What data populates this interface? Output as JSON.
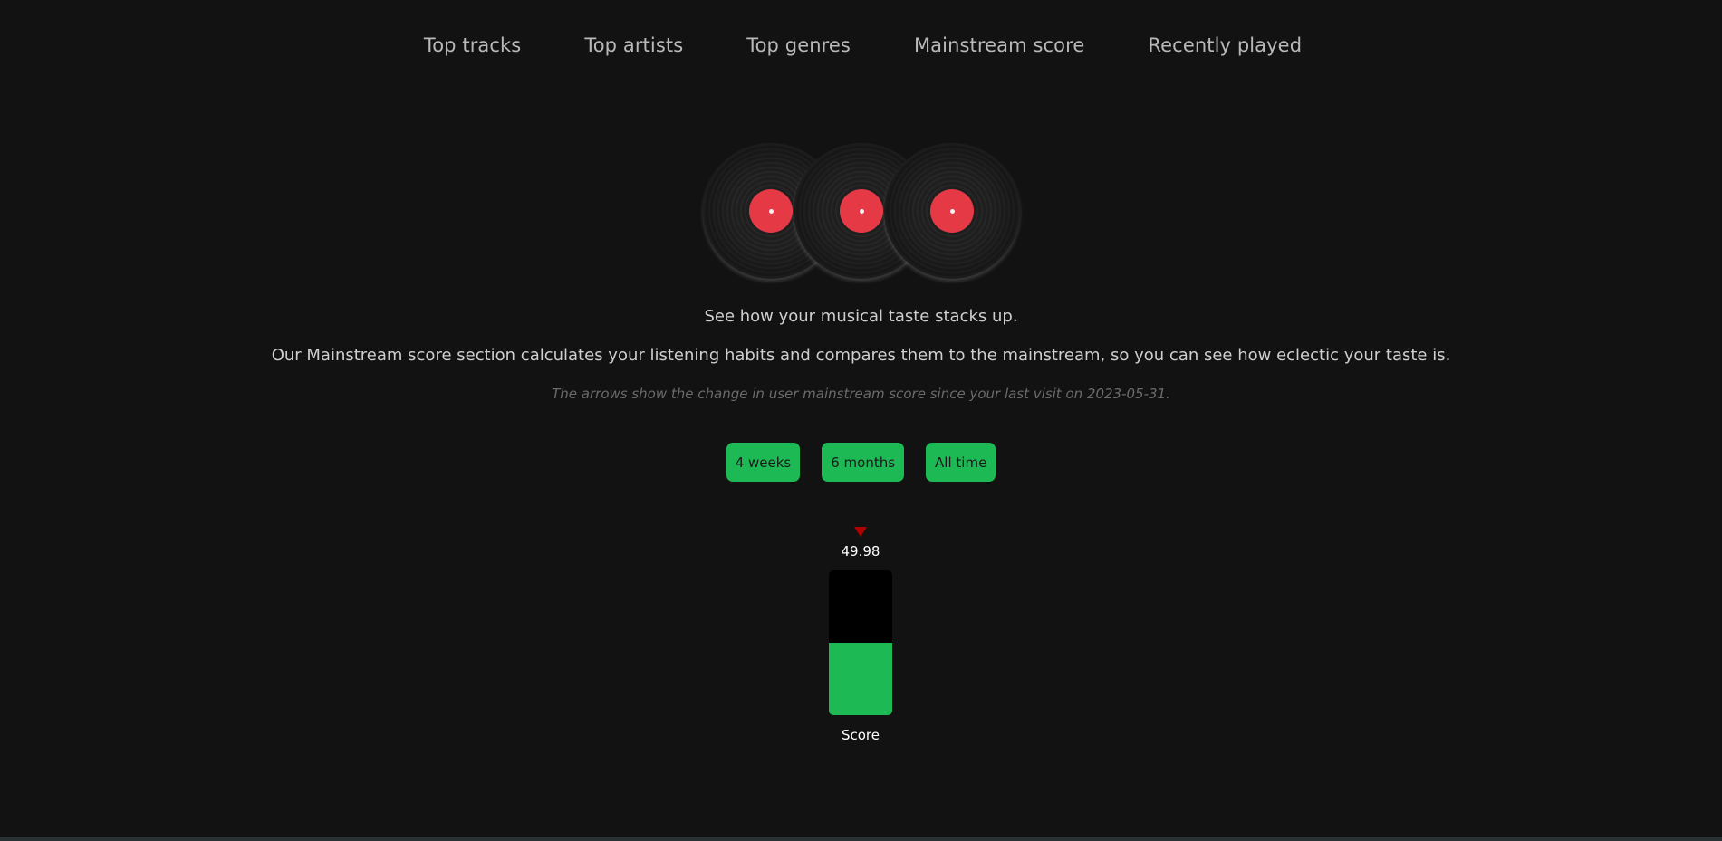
{
  "nav": {
    "items": [
      {
        "label": "Top tracks"
      },
      {
        "label": "Top artists"
      },
      {
        "label": "Top genres"
      },
      {
        "label": "Mainstream score"
      },
      {
        "label": "Recently played"
      }
    ]
  },
  "hero": {
    "icon": "vinyl-records-icon",
    "tagline": "See how your musical taste stacks up.",
    "description": "Our Mainstream score section calculates your listening habits and compares them to the mainstream, so you can see how eclectic your taste is.",
    "note": "The arrows show the change in user mainstream score since your last visit on 2023-05-31."
  },
  "periods": [
    {
      "label": "4 weeks"
    },
    {
      "label": "6 months"
    },
    {
      "label": "All time"
    }
  ],
  "score": {
    "value": "49.98",
    "fraction": 0.4998,
    "label": "Score",
    "trend": "down",
    "trend_color": "#b00000",
    "fill_color": "#1db954"
  },
  "colors": {
    "background": "#121212",
    "accent": "#1db954",
    "record_label": "#e63946"
  }
}
